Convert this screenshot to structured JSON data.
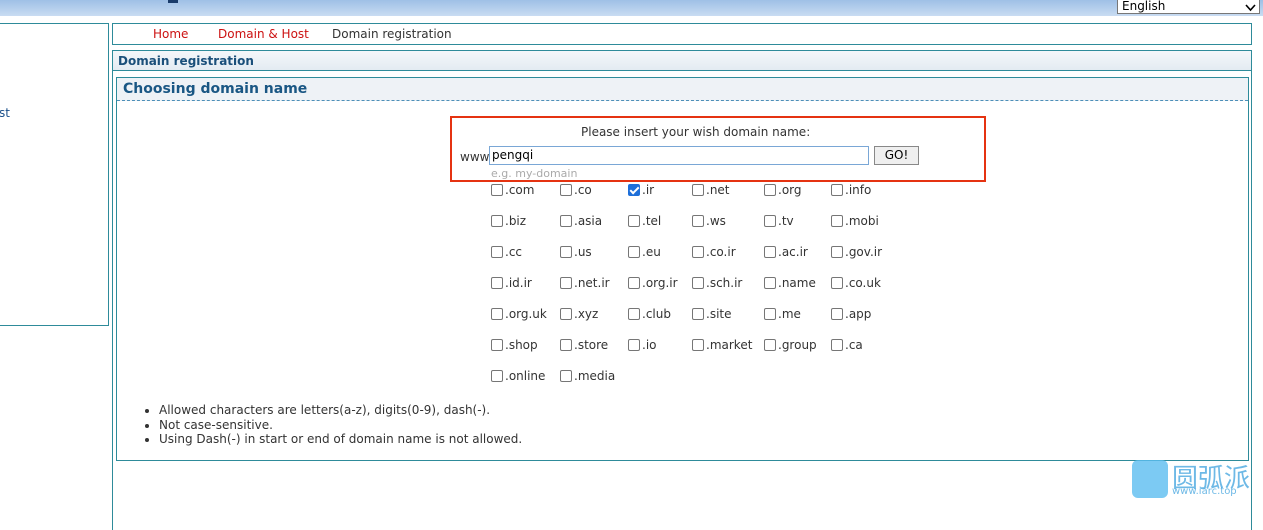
{
  "header": {
    "language_selected": "English"
  },
  "left_panel": {
    "fragment": "st"
  },
  "breadcrumb": {
    "home": "Home",
    "domain_host": "Domain & Host",
    "current": "Domain registration"
  },
  "section": {
    "title": "Domain registration"
  },
  "content": {
    "title": "Choosing domain name",
    "prompt": "Please insert your wish domain name:",
    "www_label": "www.",
    "input_value": "pengqi",
    "go_label": "GO!",
    "example": "e.g. my-domain"
  },
  "tlds": [
    {
      "label": ".com",
      "checked": false
    },
    {
      "label": ".co",
      "checked": false
    },
    {
      "label": ".ir",
      "checked": true
    },
    {
      "label": ".net",
      "checked": false
    },
    {
      "label": ".org",
      "checked": false
    },
    {
      "label": ".info",
      "checked": false
    },
    {
      "label": ".biz",
      "checked": false
    },
    {
      "label": ".asia",
      "checked": false
    },
    {
      "label": ".tel",
      "checked": false
    },
    {
      "label": ".ws",
      "checked": false
    },
    {
      "label": ".tv",
      "checked": false
    },
    {
      "label": ".mobi",
      "checked": false
    },
    {
      "label": ".cc",
      "checked": false
    },
    {
      "label": ".us",
      "checked": false
    },
    {
      "label": ".eu",
      "checked": false
    },
    {
      "label": ".co.ir",
      "checked": false
    },
    {
      "label": ".ac.ir",
      "checked": false
    },
    {
      "label": ".gov.ir",
      "checked": false
    },
    {
      "label": ".id.ir",
      "checked": false
    },
    {
      "label": ".net.ir",
      "checked": false
    },
    {
      "label": ".org.ir",
      "checked": false
    },
    {
      "label": ".sch.ir",
      "checked": false
    },
    {
      "label": ".name",
      "checked": false
    },
    {
      "label": ".co.uk",
      "checked": false
    },
    {
      "label": ".org.uk",
      "checked": false
    },
    {
      "label": ".xyz",
      "checked": false
    },
    {
      "label": ".club",
      "checked": false
    },
    {
      "label": ".site",
      "checked": false
    },
    {
      "label": ".me",
      "checked": false
    },
    {
      "label": ".app",
      "checked": false
    },
    {
      "label": ".shop",
      "checked": false
    },
    {
      "label": ".store",
      "checked": false
    },
    {
      "label": ".io",
      "checked": false
    },
    {
      "label": ".market",
      "checked": false
    },
    {
      "label": ".group",
      "checked": false
    },
    {
      "label": ".ca",
      "checked": false
    },
    {
      "label": ".online",
      "checked": false
    },
    {
      "label": ".media",
      "checked": false
    }
  ],
  "rules": [
    "Allowed characters are letters(a-z), digits(0-9), dash(-).",
    "Not case-sensitive.",
    "Using Dash(-) in start or end of domain name is not allowed."
  ],
  "watermark": {
    "name": "圆弧派",
    "url": "www.iarc.top"
  },
  "colors": {
    "accent_red": "#e53311",
    "link_red": "#cc1111",
    "title_blue": "#1a5784",
    "border_teal": "#2e8b9a"
  }
}
